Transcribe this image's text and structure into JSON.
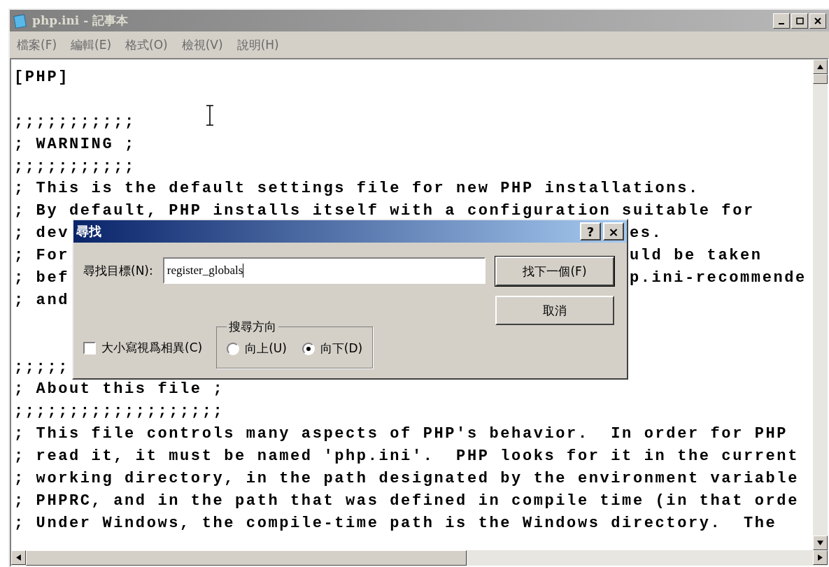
{
  "window": {
    "title": "php.ini - 記事本"
  },
  "menu": [
    "檔案(F)",
    "編輯(E)",
    "格式(O)",
    "檢視(V)",
    "說明(H)"
  ],
  "editor": {
    "lines": [
      {
        "kind": "text",
        "text": "[PHP]"
      },
      {
        "kind": "blank"
      },
      {
        "kind": "text",
        "text": ";;;;;;;;;;;"
      },
      {
        "kind": "text",
        "text": "; WARNING ;"
      },
      {
        "kind": "text",
        "text": ";;;;;;;;;;;"
      },
      {
        "kind": "text",
        "text": "; This is the default settings file for new PHP installations."
      },
      {
        "kind": "text",
        "text": "; By default, PHP installs itself with a configuration suitable for"
      },
      {
        "kind": "text",
        "text": "; dev",
        "text_right": "es."
      },
      {
        "kind": "text",
        "text": "; For",
        "text_right": "uld be taken"
      },
      {
        "kind": "text",
        "text": "; bef",
        "text_right": "p.ini-recommende"
      },
      {
        "kind": "text",
        "text": "; and"
      },
      {
        "kind": "blank"
      },
      {
        "kind": "blank"
      },
      {
        "kind": "text",
        "text": ";;;;;"
      },
      {
        "kind": "text",
        "text": "; About this file ;"
      },
      {
        "kind": "text",
        "text": ";;;;;;;;;;;;;;;;;;;"
      },
      {
        "kind": "text",
        "text": "; This file controls many aspects of PHP's behavior.  In order for PHP"
      },
      {
        "kind": "text",
        "text": "; read it, it must be named 'php.ini'.  PHP looks for it in the current"
      },
      {
        "kind": "text",
        "text": "; working directory, in the path designated by the environment variable"
      },
      {
        "kind": "text",
        "text": "; PHPRC, and in the path that was defined in compile time (in that orde"
      },
      {
        "kind": "text",
        "text": "; Under Windows, the compile-time path is the Windows directory.  The"
      }
    ]
  },
  "find_dialog": {
    "title": "尋找",
    "help_button": "?",
    "close_button": "×",
    "label": "尋找目標(N):",
    "value": "register_globals",
    "find_next_button": "找下一個(F)",
    "cancel_button": "取消",
    "match_case": {
      "label": "大小寫視爲相異(C)",
      "checked": false
    },
    "direction": {
      "title": "搜尋方向",
      "options": [
        {
          "label": "向上(U)",
          "selected": false
        },
        {
          "label": "向下(D)",
          "selected": true
        }
      ]
    }
  }
}
